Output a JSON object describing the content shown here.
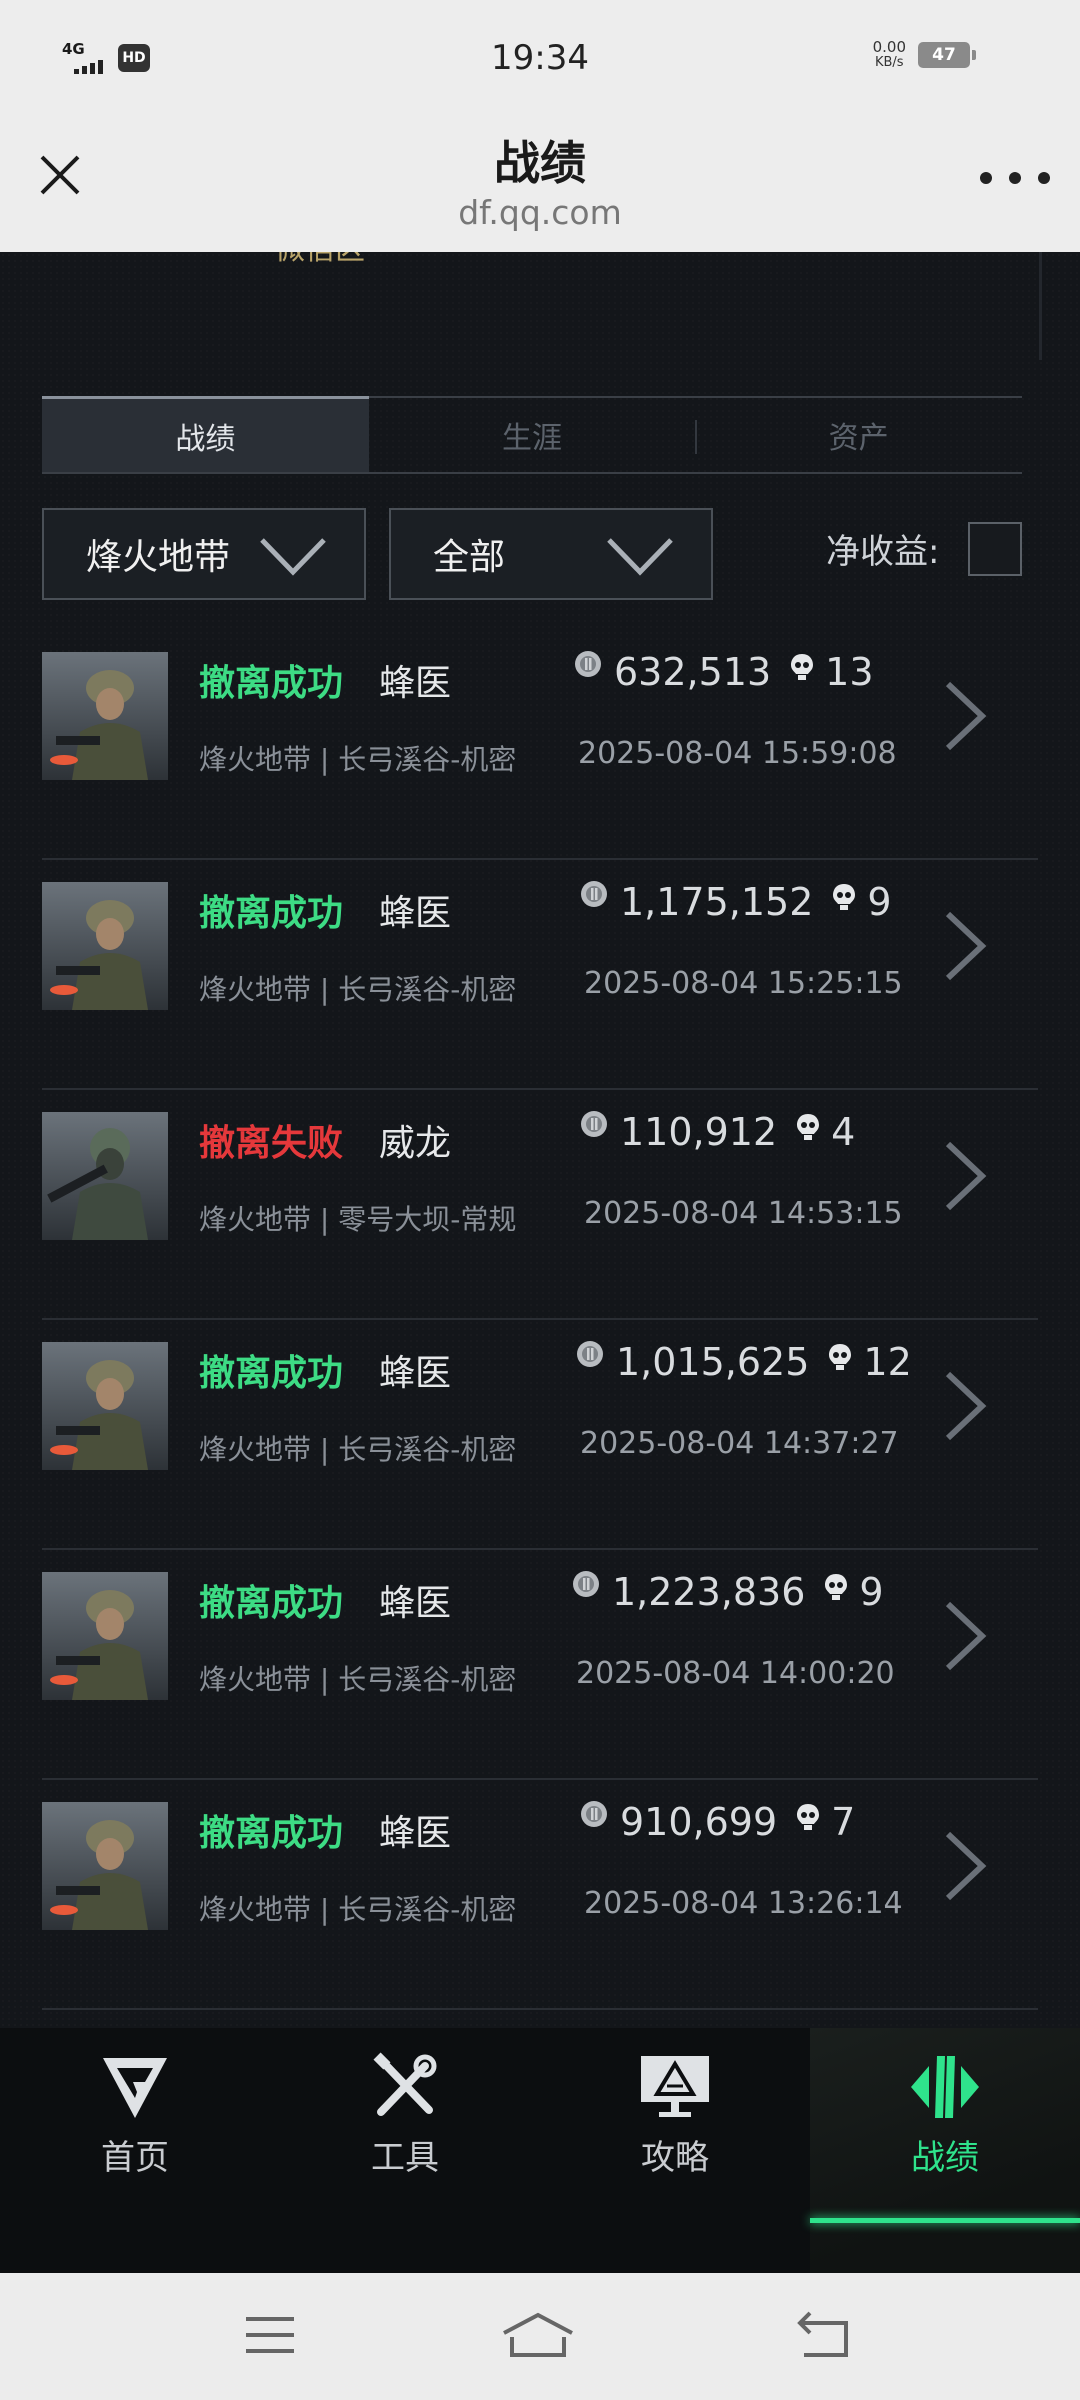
{
  "status_bar": {
    "network": "4G",
    "hd": "HD",
    "time": "19:34",
    "speed_value": "0.00",
    "speed_unit": "KB/s",
    "battery": "47"
  },
  "title_bar": {
    "title": "战绩",
    "url": "df.qq.com"
  },
  "partial_text": "微信区",
  "tabs": [
    {
      "label": "战绩",
      "active": true
    },
    {
      "label": "生涯",
      "active": false
    },
    {
      "label": "资产",
      "active": false
    }
  ],
  "filters": {
    "mode_selected": "烽火地带",
    "scope_selected": "全部",
    "net_income_label": "净收益:"
  },
  "records": [
    {
      "status": "撤离成功",
      "status_type": "success",
      "operator": "蜂医",
      "value": "632,513",
      "kills": "13",
      "location": "烽火地带 | 长弓溪谷-机密",
      "date": "2025-08-04 15:59:08"
    },
    {
      "status": "撤离成功",
      "status_type": "success",
      "operator": "蜂医",
      "value": "1,175,152",
      "kills": "9",
      "location": "烽火地带 | 长弓溪谷-机密",
      "date": "2025-08-04 15:25:15"
    },
    {
      "status": "撤离失败",
      "status_type": "fail",
      "operator": "威龙",
      "value": "110,912",
      "kills": "4",
      "location": "烽火地带 | 零号大坝-常规",
      "date": "2025-08-04 14:53:15"
    },
    {
      "status": "撤离成功",
      "status_type": "success",
      "operator": "蜂医",
      "value": "1,015,625",
      "kills": "12",
      "location": "烽火地带 | 长弓溪谷-机密",
      "date": "2025-08-04 14:37:27"
    },
    {
      "status": "撤离成功",
      "status_type": "success",
      "operator": "蜂医",
      "value": "1,223,836",
      "kills": "9",
      "location": "烽火地带 | 长弓溪谷-机密",
      "date": "2025-08-04 14:00:20"
    },
    {
      "status": "撤离成功",
      "status_type": "success",
      "operator": "蜂医",
      "value": "910,699",
      "kills": "7",
      "location": "烽火地带 | 长弓溪谷-机密",
      "date": "2025-08-04 13:26:14"
    }
  ],
  "bottom_nav": [
    {
      "label": "首页",
      "icon": "home-logo-icon",
      "active": false
    },
    {
      "label": "工具",
      "icon": "tools-icon",
      "active": false
    },
    {
      "label": "攻略",
      "icon": "guide-monitor-icon",
      "active": false
    },
    {
      "label": "战绩",
      "icon": "record-icon",
      "active": true
    }
  ],
  "colors": {
    "accent": "#2fe38c",
    "success": "#3ddc84",
    "fail": "#e5383b",
    "background": "#13161a"
  }
}
